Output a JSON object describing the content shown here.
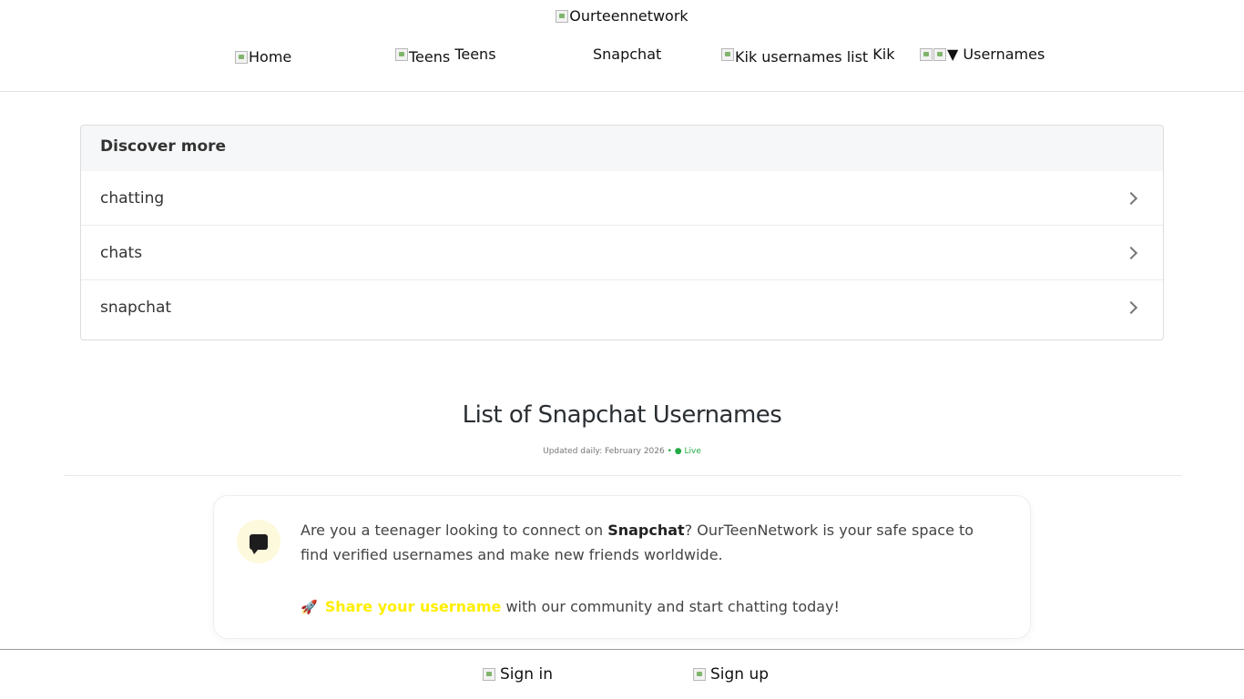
{
  "header": {
    "logo_alt": "Ourteennetwork",
    "nav": {
      "home": "Home",
      "teens_alt": "Teens",
      "teens": "Teens",
      "snapchat": "Snapchat",
      "kik_alt": "Kik usernames list",
      "kik": "Kik",
      "usernames_arrow": "▼",
      "usernames": "Usernames"
    }
  },
  "discover": {
    "title": "Discover more",
    "items": [
      "chatting",
      "chats",
      "snapchat"
    ]
  },
  "main": {
    "title": "List of Snapchat Usernames",
    "updated": "Updated daily: February 2026",
    "live": "• ● Live"
  },
  "card": {
    "icon": "chat-bubble-icon",
    "text_before": "Are you a teenager looking to connect on ",
    "text_bold": "Snapchat",
    "text_after": "? OurTeenNetwork is your safe space to find verified usernames and make new friends worldwide.",
    "cta_icon": "🚀",
    "cta_link": "Share your username",
    "cta_rest": " with our community and start chatting today!"
  },
  "footer": {
    "sign_in": "Sign in",
    "sign_up": "Sign up"
  },
  "colors": {
    "accent_yellow": "#ffee00",
    "live_green": "#22aa44",
    "chat_bg": "#fdf9dc"
  }
}
